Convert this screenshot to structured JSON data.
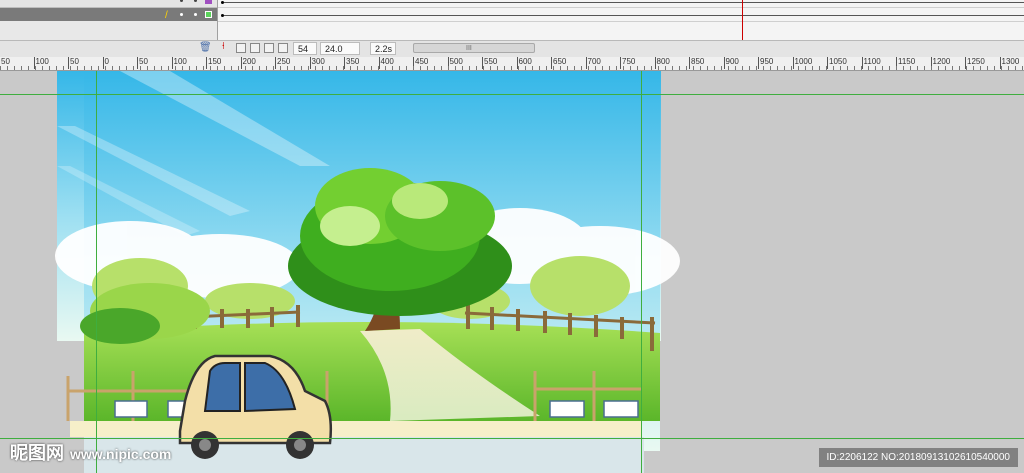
{
  "timeline": {
    "layer_row_1_label": "",
    "layer_row_2_label": ""
  },
  "toolbar": {
    "frame_number": "54",
    "frame_rate": "24.0 fps",
    "elapsed_time": "2.2s",
    "scroll_grip": "III"
  },
  "ruler": {
    "ticks": [
      "50",
      "100",
      "50",
      "0",
      "50",
      "100",
      "150",
      "200",
      "250",
      "300",
      "350",
      "400",
      "450",
      "500",
      "550",
      "600",
      "650",
      "700",
      "750",
      "800",
      "850",
      "900",
      "950",
      "1000",
      "1050",
      "1100",
      "1150",
      "1200",
      "1250",
      "1300"
    ]
  },
  "watermark": {
    "site_name": "昵图网",
    "site_url": "www.nipic.com",
    "image_info": "ID:2206122 NO:20180913102610540000"
  },
  "colors": {
    "sky_top": "#35b7e8",
    "grass": "#6fc52e",
    "tree": "#3fae1f",
    "guide": "#3fae3f",
    "playhead": "#cc0000"
  }
}
